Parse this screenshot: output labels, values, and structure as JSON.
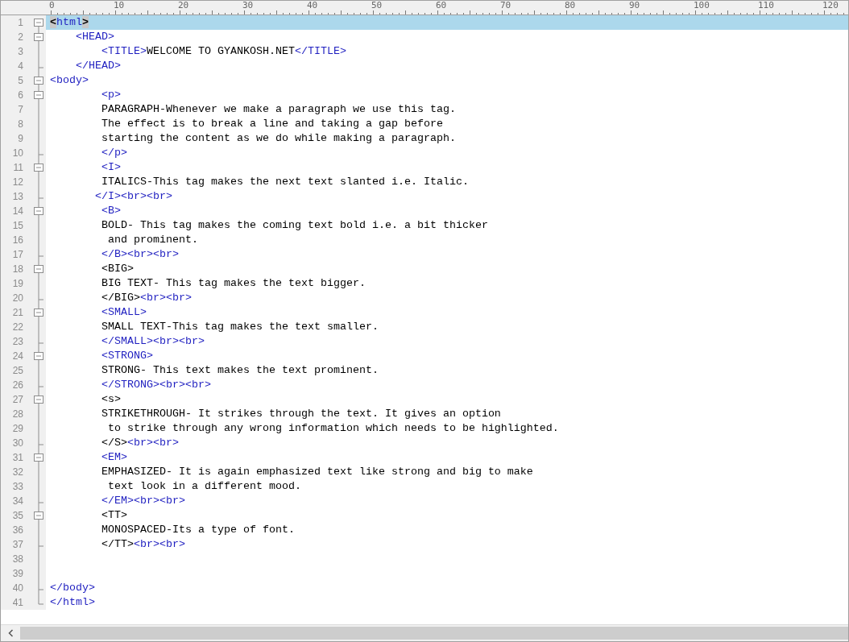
{
  "ruler": [
    "0",
    "10",
    "20",
    "30",
    "40",
    "50",
    "60",
    "70",
    "80",
    "90",
    "100",
    "110",
    "120"
  ],
  "lines": [
    {
      "number": "1",
      "kind": "open",
      "current": true,
      "segments": [
        {
          "kind": "bracket",
          "text": "<"
        },
        {
          "kind": "tag",
          "text": "html"
        },
        {
          "kind": "bracket",
          "text": ">"
        }
      ]
    },
    {
      "number": "2",
      "kind": "open",
      "current": false,
      "segments": [
        {
          "kind": "tag",
          "text": "    <HEAD>"
        }
      ]
    },
    {
      "number": "3",
      "kind": "line",
      "current": false,
      "segments": [
        {
          "kind": "tag",
          "text": "        <TITLE>"
        },
        {
          "kind": "text",
          "text": "WELCOME TO GYANKOSH.NET"
        },
        {
          "kind": "tag",
          "text": "</TITLE>"
        }
      ]
    },
    {
      "number": "4",
      "kind": "end",
      "current": false,
      "segments": [
        {
          "kind": "tag",
          "text": "    </HEAD>"
        }
      ]
    },
    {
      "number": "5",
      "kind": "open",
      "current": false,
      "segments": [
        {
          "kind": "tag",
          "text": "<body>"
        }
      ]
    },
    {
      "number": "6",
      "kind": "open",
      "current": false,
      "segments": [
        {
          "kind": "tag",
          "text": "        <p>"
        }
      ]
    },
    {
      "number": "7",
      "kind": "line",
      "current": false,
      "segments": [
        {
          "kind": "text",
          "text": "        PARAGRAPH-Whenever we make a paragraph we use this tag."
        }
      ]
    },
    {
      "number": "8",
      "kind": "line",
      "current": false,
      "segments": [
        {
          "kind": "text",
          "text": "        The effect is to break a line and taking a gap before"
        }
      ]
    },
    {
      "number": "9",
      "kind": "line",
      "current": false,
      "segments": [
        {
          "kind": "text",
          "text": "        starting the content as we do while making a paragraph."
        }
      ]
    },
    {
      "number": "10",
      "kind": "end",
      "current": false,
      "segments": [
        {
          "kind": "tag",
          "text": "        </p>"
        }
      ]
    },
    {
      "number": "11",
      "kind": "open",
      "current": false,
      "segments": [
        {
          "kind": "tag",
          "text": "        <I>"
        }
      ]
    },
    {
      "number": "12",
      "kind": "line",
      "current": false,
      "segments": [
        {
          "kind": "text",
          "text": "        ITALICS-This tag makes the next text slanted i.e. Italic."
        }
      ]
    },
    {
      "number": "13",
      "kind": "end",
      "current": false,
      "segments": [
        {
          "kind": "tag",
          "text": "       </I><br><br>"
        }
      ]
    },
    {
      "number": "14",
      "kind": "open",
      "current": false,
      "segments": [
        {
          "kind": "tag",
          "text": "        <B>"
        }
      ]
    },
    {
      "number": "15",
      "kind": "line",
      "current": false,
      "segments": [
        {
          "kind": "text",
          "text": "        BOLD- This tag makes the coming text bold i.e. a bit thicker"
        }
      ]
    },
    {
      "number": "16",
      "kind": "line",
      "current": false,
      "segments": [
        {
          "kind": "text",
          "text": "         and prominent."
        }
      ]
    },
    {
      "number": "17",
      "kind": "end",
      "current": false,
      "segments": [
        {
          "kind": "tag",
          "text": "        </B><br><br>"
        }
      ]
    },
    {
      "number": "18",
      "kind": "open",
      "current": false,
      "segments": [
        {
          "kind": "text",
          "text": "        <BIG>"
        }
      ]
    },
    {
      "number": "19",
      "kind": "line",
      "current": false,
      "segments": [
        {
          "kind": "text",
          "text": "        BIG TEXT- This tag makes the text bigger."
        }
      ]
    },
    {
      "number": "20",
      "kind": "end",
      "current": false,
      "segments": [
        {
          "kind": "text",
          "text": "        </BIG>"
        },
        {
          "kind": "tag",
          "text": "<br><br>"
        }
      ]
    },
    {
      "number": "21",
      "kind": "open",
      "current": false,
      "segments": [
        {
          "kind": "tag",
          "text": "        <SMALL>"
        }
      ]
    },
    {
      "number": "22",
      "kind": "line",
      "current": false,
      "segments": [
        {
          "kind": "text",
          "text": "        SMALL TEXT-This tag makes the text smaller."
        }
      ]
    },
    {
      "number": "23",
      "kind": "end",
      "current": false,
      "segments": [
        {
          "kind": "tag",
          "text": "        </SMALL><br><br>"
        }
      ]
    },
    {
      "number": "24",
      "kind": "open",
      "current": false,
      "segments": [
        {
          "kind": "tag",
          "text": "        <STRONG>"
        }
      ]
    },
    {
      "number": "25",
      "kind": "line",
      "current": false,
      "segments": [
        {
          "kind": "text",
          "text": "        STRONG- This text makes the text prominent."
        }
      ]
    },
    {
      "number": "26",
      "kind": "end",
      "current": false,
      "segments": [
        {
          "kind": "tag",
          "text": "        </STRONG><br><br>"
        }
      ]
    },
    {
      "number": "27",
      "kind": "open",
      "current": false,
      "segments": [
        {
          "kind": "text",
          "text": "        <s>"
        }
      ]
    },
    {
      "number": "28",
      "kind": "line",
      "current": false,
      "segments": [
        {
          "kind": "text",
          "text": "        STRIKETHROUGH- It strikes through the text. It gives an option"
        }
      ]
    },
    {
      "number": "29",
      "kind": "line",
      "current": false,
      "segments": [
        {
          "kind": "text",
          "text": "         to strike through any wrong information which needs to be highlighted."
        }
      ]
    },
    {
      "number": "30",
      "kind": "end",
      "current": false,
      "segments": [
        {
          "kind": "text",
          "text": "        </S>"
        },
        {
          "kind": "tag",
          "text": "<br><br>"
        }
      ]
    },
    {
      "number": "31",
      "kind": "open",
      "current": false,
      "segments": [
        {
          "kind": "tag",
          "text": "        <EM>"
        }
      ]
    },
    {
      "number": "32",
      "kind": "line",
      "current": false,
      "segments": [
        {
          "kind": "text",
          "text": "        EMPHASIZED- It is again emphasized text like strong and big to make"
        }
      ]
    },
    {
      "number": "33",
      "kind": "line",
      "current": false,
      "segments": [
        {
          "kind": "text",
          "text": "         text look in a different mood."
        }
      ]
    },
    {
      "number": "34",
      "kind": "end",
      "current": false,
      "segments": [
        {
          "kind": "tag",
          "text": "        </EM><br><br>"
        }
      ]
    },
    {
      "number": "35",
      "kind": "open",
      "current": false,
      "segments": [
        {
          "kind": "text",
          "text": "        <TT>"
        }
      ]
    },
    {
      "number": "36",
      "kind": "line",
      "current": false,
      "segments": [
        {
          "kind": "text",
          "text": "        MONOSPACED-Its a type of font."
        }
      ]
    },
    {
      "number": "37",
      "kind": "end",
      "current": false,
      "segments": [
        {
          "kind": "text",
          "text": "        </TT>"
        },
        {
          "kind": "tag",
          "text": "<br><br>"
        }
      ]
    },
    {
      "number": "38",
      "kind": "line",
      "current": false
    },
    {
      "number": "39",
      "kind": "line",
      "current": false
    },
    {
      "number": "40",
      "kind": "end",
      "current": false,
      "segments": [
        {
          "kind": "tag",
          "text": "</body>"
        }
      ]
    },
    {
      "number": "41",
      "kind": "last",
      "current": false,
      "segments": [
        {
          "kind": "tag",
          "text": "</html>"
        }
      ]
    }
  ]
}
